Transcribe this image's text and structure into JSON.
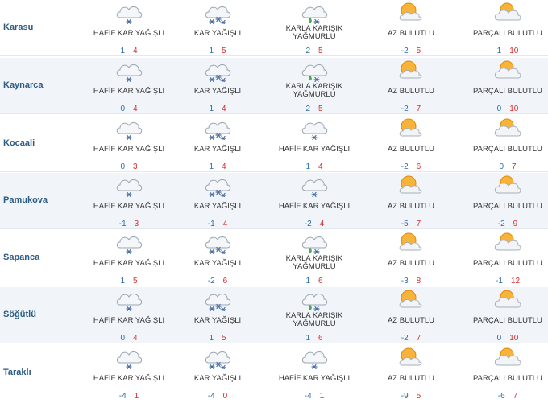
{
  "colors": {
    "city_text": "#2d5c84",
    "min_temp": "#2f6aa8",
    "max_temp": "#d32f2f",
    "alt_row_bg": "#f1f5fa"
  },
  "rows": [
    {
      "city": "Karasu",
      "days": [
        {
          "icon": "light-snow-icon",
          "condition": "HAFİF KAR YAĞIŞLI",
          "min": "1",
          "max": "4"
        },
        {
          "icon": "snow-icon",
          "condition": "KAR YAĞIŞLI",
          "min": "1",
          "max": "5"
        },
        {
          "icon": "sleet-icon",
          "condition": "KARLA KARIŞIK YAĞMURLU",
          "min": "2",
          "max": "5"
        },
        {
          "icon": "mostly-sunny-icon",
          "condition": "AZ BULUTLU",
          "min": "-2",
          "max": "5"
        },
        {
          "icon": "partly-cloudy-icon",
          "condition": "PARÇALI BULUTLU",
          "min": "1",
          "max": "10"
        }
      ]
    },
    {
      "city": "Kaynarca",
      "days": [
        {
          "icon": "light-snow-icon",
          "condition": "HAFİF KAR YAĞIŞLI",
          "min": "0",
          "max": "4"
        },
        {
          "icon": "snow-icon",
          "condition": "KAR YAĞIŞLI",
          "min": "1",
          "max": "4"
        },
        {
          "icon": "sleet-icon",
          "condition": "KARLA KARIŞIK YAĞMURLU",
          "min": "2",
          "max": "5"
        },
        {
          "icon": "mostly-sunny-icon",
          "condition": "AZ BULUTLU",
          "min": "-2",
          "max": "7"
        },
        {
          "icon": "partly-cloudy-icon",
          "condition": "PARÇALI BULUTLU",
          "min": "0",
          "max": "10"
        }
      ]
    },
    {
      "city": "Kocaali",
      "days": [
        {
          "icon": "light-snow-icon",
          "condition": "HAFİF KAR YAĞIŞLI",
          "min": "0",
          "max": "3"
        },
        {
          "icon": "snow-icon",
          "condition": "KAR YAĞIŞLI",
          "min": "1",
          "max": "4"
        },
        {
          "icon": "light-snow-icon",
          "condition": "HAFİF KAR YAĞIŞLI",
          "min": "1",
          "max": "4"
        },
        {
          "icon": "mostly-sunny-icon",
          "condition": "AZ BULUTLU",
          "min": "-2",
          "max": "6"
        },
        {
          "icon": "partly-cloudy-icon",
          "condition": "PARÇALI BULUTLU",
          "min": "0",
          "max": "7"
        }
      ]
    },
    {
      "city": "Pamukova",
      "days": [
        {
          "icon": "light-snow-icon",
          "condition": "HAFİF KAR YAĞIŞLI",
          "min": "-1",
          "max": "3"
        },
        {
          "icon": "snow-icon",
          "condition": "KAR YAĞIŞLI",
          "min": "-1",
          "max": "4"
        },
        {
          "icon": "light-snow-icon",
          "condition": "HAFİF KAR YAĞIŞLI",
          "min": "-2",
          "max": "4"
        },
        {
          "icon": "mostly-sunny-icon",
          "condition": "AZ BULUTLU",
          "min": "-5",
          "max": "7"
        },
        {
          "icon": "partly-cloudy-icon",
          "condition": "PARÇALI BULUTLU",
          "min": "-2",
          "max": "9"
        }
      ]
    },
    {
      "city": "Sapanca",
      "days": [
        {
          "icon": "light-snow-icon",
          "condition": "HAFİF KAR YAĞIŞLI",
          "min": "1",
          "max": "5"
        },
        {
          "icon": "snow-icon",
          "condition": "KAR YAĞIŞLI",
          "min": "-2",
          "max": "6"
        },
        {
          "icon": "sleet-icon",
          "condition": "KARLA KARIŞIK YAĞMURLU",
          "min": "1",
          "max": "6"
        },
        {
          "icon": "mostly-sunny-icon",
          "condition": "AZ BULUTLU",
          "min": "-3",
          "max": "8"
        },
        {
          "icon": "partly-cloudy-icon",
          "condition": "PARÇALI BULUTLU",
          "min": "-1",
          "max": "12"
        }
      ]
    },
    {
      "city": "Söğütlü",
      "days": [
        {
          "icon": "light-snow-icon",
          "condition": "HAFİF KAR YAĞIŞLI",
          "min": "0",
          "max": "4"
        },
        {
          "icon": "snow-icon",
          "condition": "KAR YAĞIŞLI",
          "min": "1",
          "max": "5"
        },
        {
          "icon": "sleet-icon",
          "condition": "KARLA KARIŞIK YAĞMURLU",
          "min": "1",
          "max": "6"
        },
        {
          "icon": "mostly-sunny-icon",
          "condition": "AZ BULUTLU",
          "min": "-2",
          "max": "7"
        },
        {
          "icon": "partly-cloudy-icon",
          "condition": "PARÇALI BULUTLU",
          "min": "0",
          "max": "10"
        }
      ]
    },
    {
      "city": "Taraklı",
      "days": [
        {
          "icon": "light-snow-icon",
          "condition": "HAFİF KAR YAĞIŞLI",
          "min": "-4",
          "max": "1"
        },
        {
          "icon": "snow-icon",
          "condition": "KAR YAĞIŞLI",
          "min": "-4",
          "max": "0"
        },
        {
          "icon": "light-snow-icon",
          "condition": "HAFİF KAR YAĞIŞLI",
          "min": "-4",
          "max": "1"
        },
        {
          "icon": "mostly-sunny-icon",
          "condition": "AZ BULUTLU",
          "min": "-9",
          "max": "5"
        },
        {
          "icon": "partly-cloudy-icon",
          "condition": "PARÇALI BULUTLU",
          "min": "-6",
          "max": "7"
        }
      ]
    }
  ]
}
